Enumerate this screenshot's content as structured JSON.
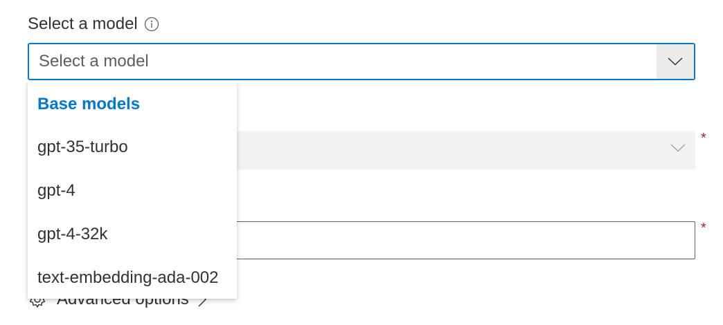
{
  "model_field": {
    "label": "Select a model",
    "info_icon": "info-icon",
    "placeholder": "Select a model",
    "chevron_icon": "chevron-down-icon",
    "focus_color": "#0078d4"
  },
  "dropdown": {
    "group_header": "Base models",
    "options": [
      "gpt-35-turbo",
      "gpt-4",
      "gpt-4-32k",
      "text-embedding-ada-002"
    ]
  },
  "required_marker": "*",
  "advanced": {
    "label": "Advanced options",
    "icon": "gear-icon",
    "chevron_icon": "chevron-right-icon"
  },
  "colors": {
    "accent": "#0078d4",
    "required": "#a4262c",
    "disabled_bg": "#f3f2f1"
  }
}
